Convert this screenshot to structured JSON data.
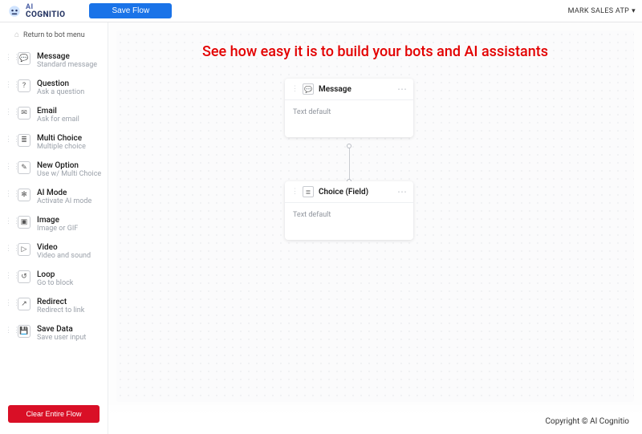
{
  "header": {
    "logo_line1": "AI",
    "logo_line2": "COGNITIO",
    "save_label": "Save Flow",
    "user_label": "MARK SALES ATP"
  },
  "sidebar": {
    "return_label": "Return to bot menu",
    "blocks": [
      {
        "title": "Message",
        "sub": "Standard message",
        "glyph": "💬"
      },
      {
        "title": "Question",
        "sub": "Ask a question",
        "glyph": "?"
      },
      {
        "title": "Email",
        "sub": "Ask for email",
        "glyph": "✉"
      },
      {
        "title": "Multi Choice",
        "sub": "Multiple choice",
        "glyph": "≣"
      },
      {
        "title": "New Option",
        "sub": "Use w/ Multi Choice",
        "glyph": "✎"
      },
      {
        "title": "AI Mode",
        "sub": "Activate AI mode",
        "glyph": "✻"
      },
      {
        "title": "Image",
        "sub": "Image or GIF",
        "glyph": "▣"
      },
      {
        "title": "Video",
        "sub": "Video and sound",
        "glyph": "▷"
      },
      {
        "title": "Loop",
        "sub": "Go to block",
        "glyph": "↺"
      },
      {
        "title": "Redirect",
        "sub": "Redirect to link",
        "glyph": "↗"
      },
      {
        "title": "Save Data",
        "sub": "Save user input",
        "glyph": "💾"
      }
    ],
    "clear_label": "Clear Entire Flow"
  },
  "canvas": {
    "headline": "See how easy it is to build your bots and AI assistants",
    "nodes": [
      {
        "title": "Message",
        "body": "Text default",
        "glyph": "💬"
      },
      {
        "title": "Choice (Field)",
        "body": "Text default",
        "glyph": "≣"
      }
    ]
  },
  "footer": {
    "copyright": "Copyright © AI Cognitio"
  }
}
